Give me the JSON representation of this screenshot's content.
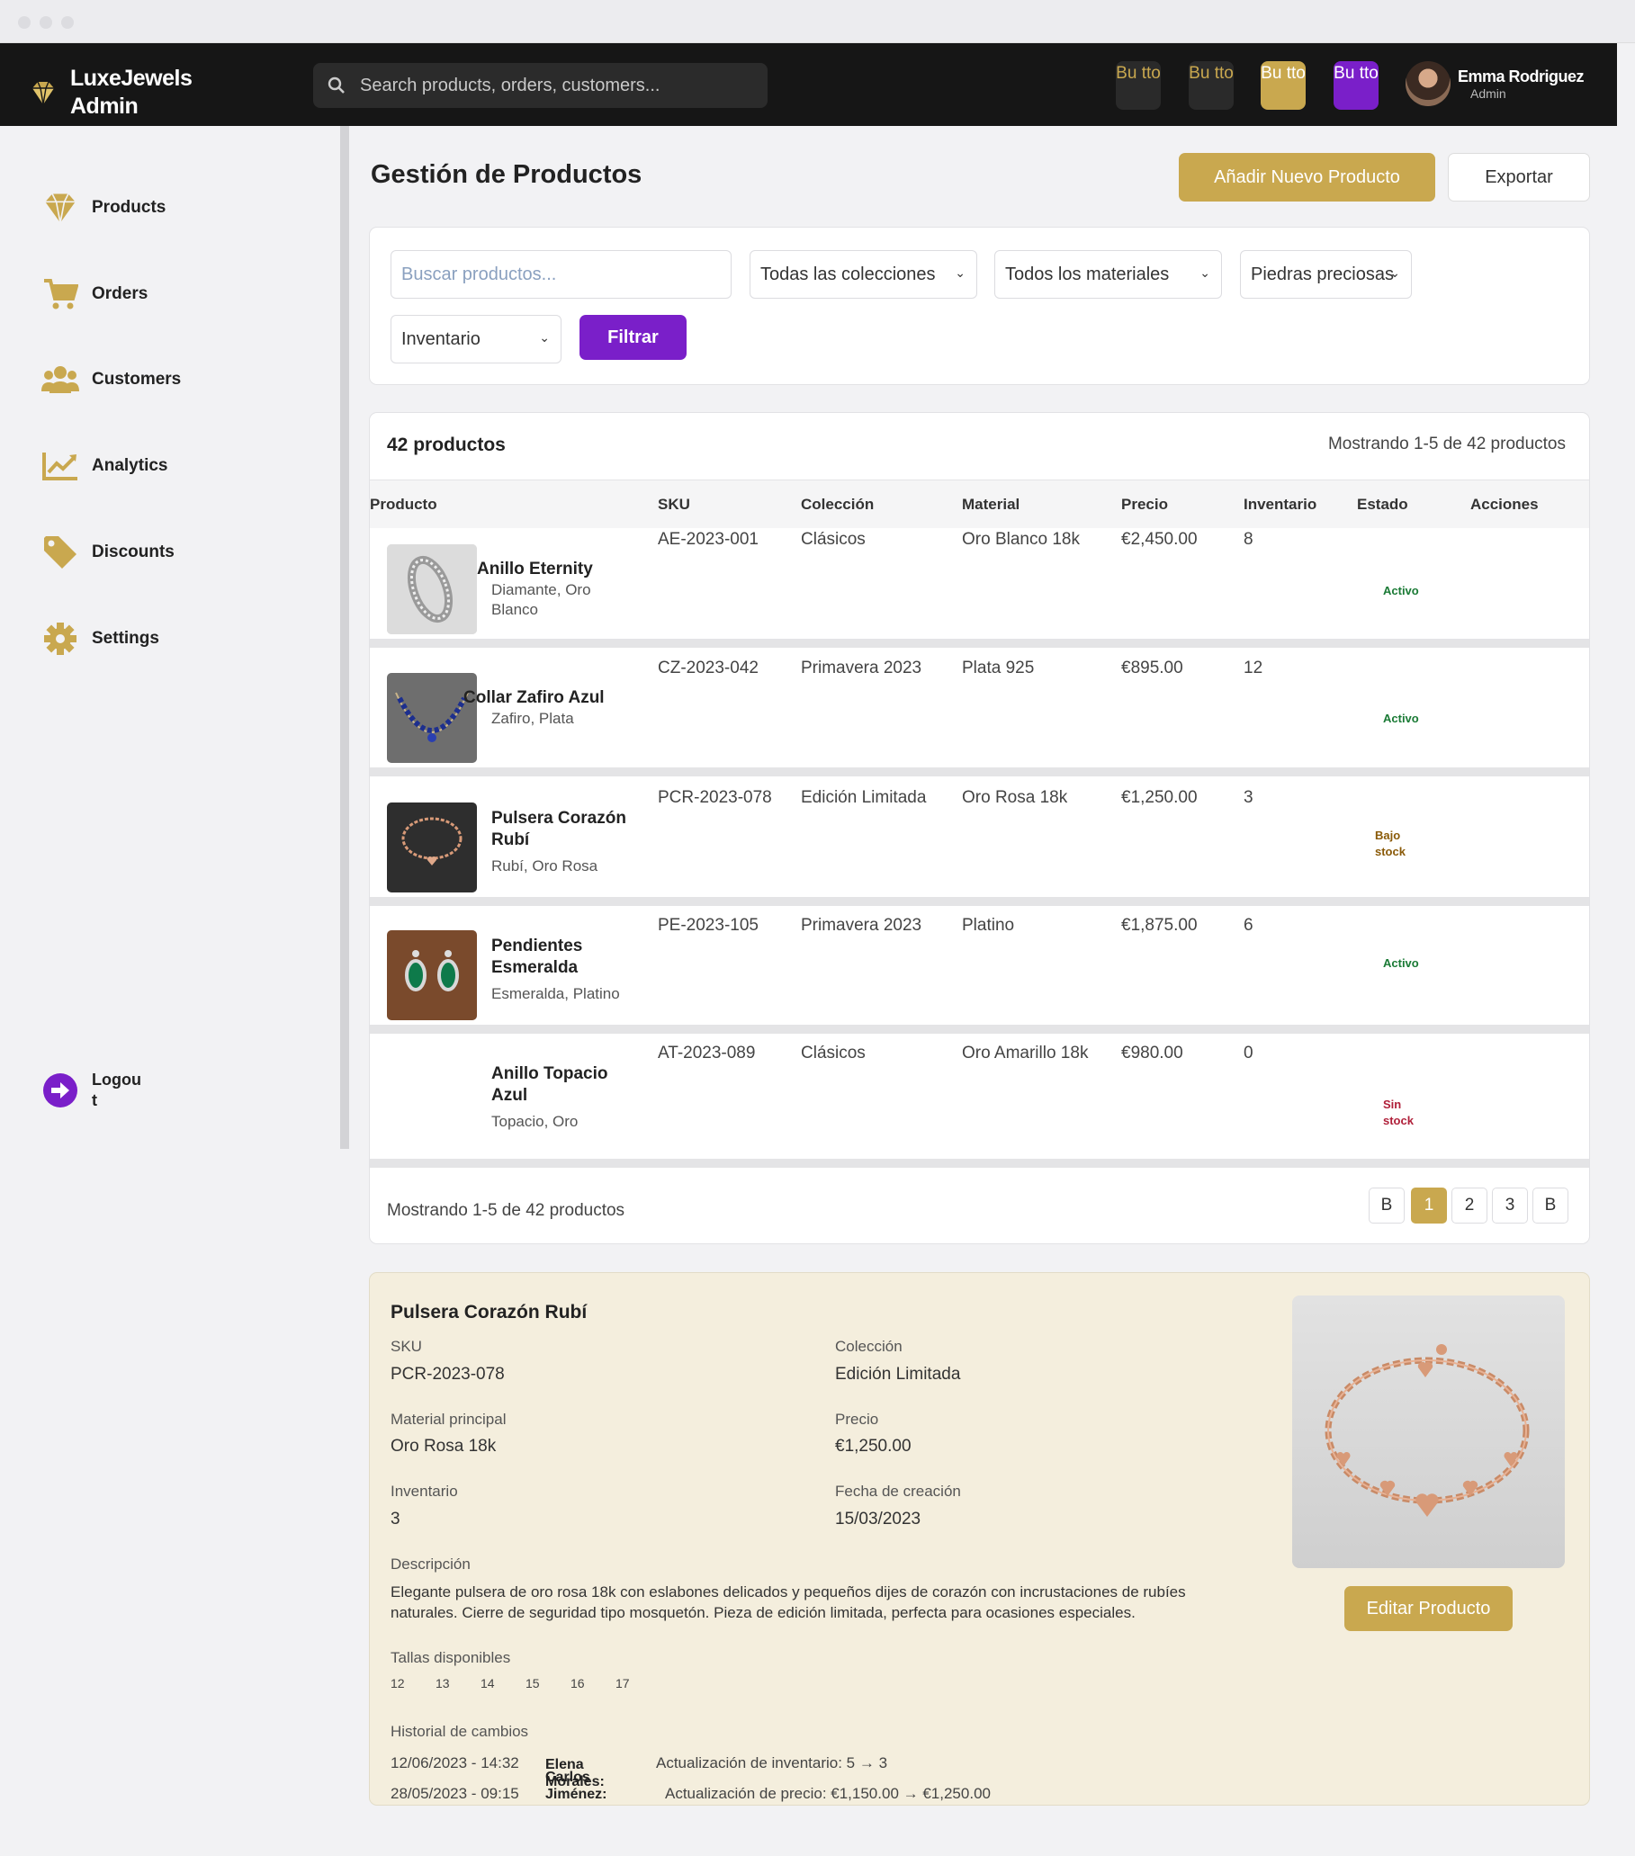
{
  "topbar": {
    "brand": "LuxeJewels Admin",
    "search_placeholder": "Search products, orders, customers...",
    "buttons": [
      "Bu tto",
      "Bu tto",
      "Bu tto",
      "Bu tto"
    ],
    "user_name": "Emma Rodriguez",
    "user_role": "Admin"
  },
  "sidebar": {
    "items": [
      {
        "label": "Products",
        "icon": "diamond-icon"
      },
      {
        "label": "Orders",
        "icon": "cart-icon"
      },
      {
        "label": "Customers",
        "icon": "users-icon"
      },
      {
        "label": "Analytics",
        "icon": "chart-icon"
      },
      {
        "label": "Discounts",
        "icon": "tag-icon"
      },
      {
        "label": "Settings",
        "icon": "gear-icon"
      }
    ],
    "logout": "Logout"
  },
  "page": {
    "title": "Gestión de Productos",
    "add_button": "Añadir Nuevo Producto",
    "export_button": "Exportar"
  },
  "filters": {
    "search_placeholder": "Buscar productos...",
    "collections": "Todas las colecciones",
    "materials": "Todos los materiales",
    "stones": "Piedras preciosas",
    "inventory": "Inventario",
    "filter_button": "Filtrar"
  },
  "table": {
    "count": "42 productos",
    "showing": "Mostrando 1-5 de 42 productos",
    "headers": [
      "Producto",
      "SKU",
      "Colección",
      "Material",
      "Precio",
      "Inventario",
      "Estado",
      "Acciones"
    ],
    "rows": [
      {
        "name": "Anillo Eternity",
        "materials": "Diamante, Oro Blanco",
        "sku": "AE-2023-001",
        "collection": "Clásicos",
        "material": "Oro Blanco 18k",
        "price": "€2,450.00",
        "inventory": "8",
        "status": "Activo",
        "status_color": "#1a7a35"
      },
      {
        "name": "Collar Zafiro Azul",
        "materials": "Zafiro, Plata",
        "sku": "CZ-2023-042",
        "collection": "Primavera 2023",
        "material": "Plata 925",
        "price": "€895.00",
        "inventory": "12",
        "status": "Activo",
        "status_color": "#1a7a35"
      },
      {
        "name": "Pulsera Corazón Rubí",
        "materials": "Rubí, Oro Rosa",
        "sku": "PCR-2023-078",
        "collection": "Edición Limitada",
        "material": "Oro Rosa 18k",
        "price": "€1,250.00",
        "inventory": "3",
        "status": "Bajo stock",
        "status_color": "#8a5a08"
      },
      {
        "name": "Pendientes Esmeralda",
        "materials": "Esmeralda, Platino",
        "sku": "PE-2023-105",
        "collection": "Primavera 2023",
        "material": "Platino",
        "price": "€1,875.00",
        "inventory": "6",
        "status": "Activo",
        "status_color": "#1a7a35"
      },
      {
        "name": "Anillo Topacio Azul",
        "materials": "Topacio, Oro",
        "sku": "AT-2023-089",
        "collection": "Clásicos",
        "material": "Oro Amarillo 18k",
        "price": "€980.00",
        "inventory": "0",
        "status": "Sin stock",
        "status_color": "#b0203a"
      }
    ],
    "footer": "Mostrando 1-5 de 42 productos",
    "pagination": [
      "B",
      "1",
      "2",
      "3",
      "B"
    ]
  },
  "detail": {
    "title": "Pulsera Corazón Rubí",
    "sku_label": "SKU",
    "sku": "PCR-2023-078",
    "collection_label": "Colección",
    "collection": "Edición Limitada",
    "material_label": "Material principal",
    "material": "Oro Rosa 18k",
    "price_label": "Precio",
    "price": "€1,250.00",
    "inventory_label": "Inventario",
    "inventory": "3",
    "created_label": "Fecha de creación",
    "created": "15/03/2023",
    "desc_label": "Descripción",
    "description": "Elegante pulsera de oro rosa 18k con eslabones delicados y pequeños dijes de corazón con incrustaciones de rubíes naturales. Cierre de seguridad tipo mosquetón. Pieza de edición limitada, perfecta para ocasiones especiales.",
    "sizes_label": "Tallas disponibles",
    "sizes": [
      "12",
      "13",
      "14",
      "15",
      "16",
      "17"
    ],
    "history_label": "Historial de cambios",
    "history": [
      {
        "date": "12/06/2023 - 14:32",
        "user": "Elena Morales:",
        "change": "Actualización de inventario: 5 → 3"
      },
      {
        "date": "28/05/2023 - 09:15",
        "user": "Carlos Jiménez:",
        "change": "Actualización de precio: €1,150.00 → €1,250.00"
      }
    ],
    "edit_button": "Editar Producto"
  }
}
